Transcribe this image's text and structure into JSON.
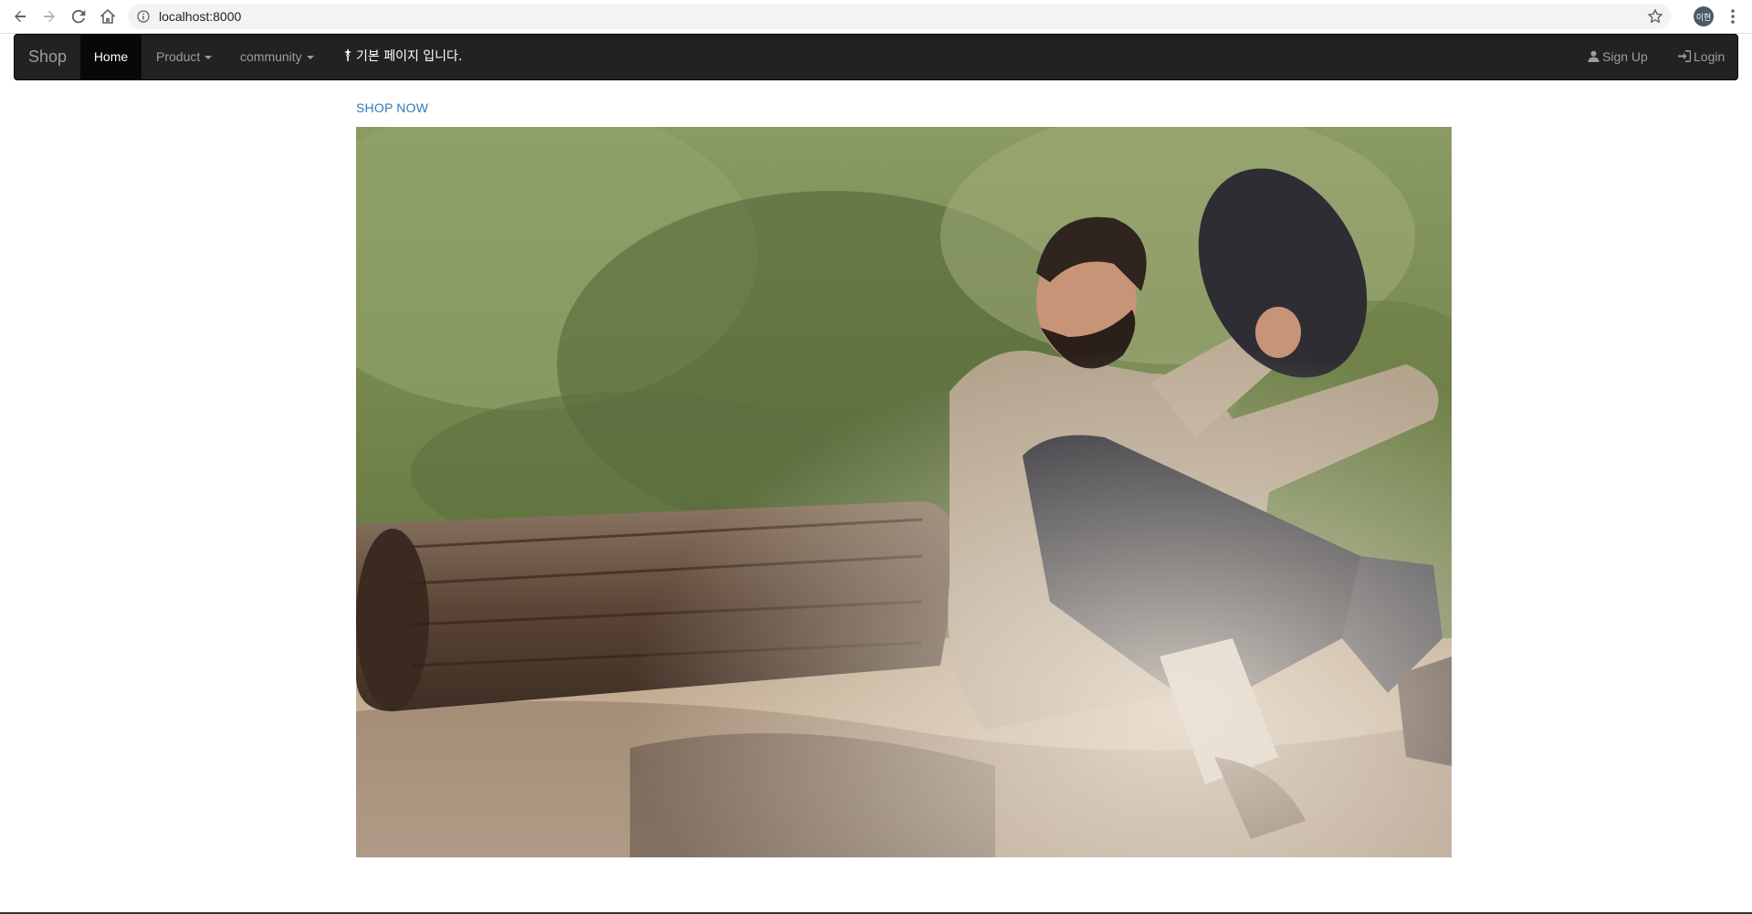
{
  "browser": {
    "url": "localhost:8000",
    "profile_initials": "이현",
    "icons": [
      "back-arrow-icon",
      "forward-arrow-icon",
      "reload-icon",
      "home-icon",
      "info-icon",
      "star-icon",
      "menu-dots-icon"
    ]
  },
  "navbar": {
    "brand": "Shop",
    "items": [
      {
        "label": "Home",
        "active": true
      },
      {
        "label": "Product",
        "dropdown": true
      },
      {
        "label": "community",
        "dropdown": true
      }
    ],
    "notice": "기본 페이지 입니다.",
    "notice_icon": "grave-icon",
    "right": [
      {
        "label": "Sign Up",
        "icon": "user-icon"
      },
      {
        "label": "Login",
        "icon": "login-icon"
      }
    ],
    "colors": {
      "background": "#222222",
      "text": "#9d9d9d",
      "active_bg": "#080808",
      "active_text": "#ffffff"
    }
  },
  "main": {
    "shop_now": "SHOP NOW",
    "link_color": "#337ab7",
    "hero_image": "man-sitting-by-log-photo"
  }
}
